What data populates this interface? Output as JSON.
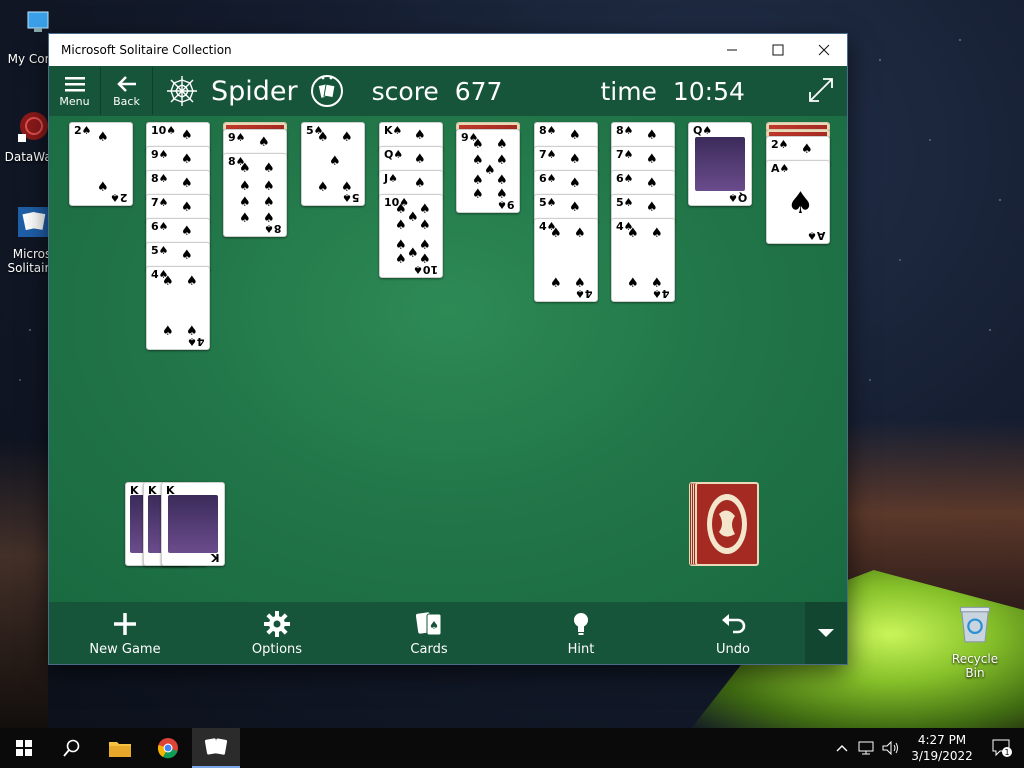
{
  "desktop": {
    "icons": [
      {
        "label": "My Com",
        "name": "my-computer"
      },
      {
        "label": "DataWag",
        "name": "datawag"
      },
      {
        "label": "Micros Solitaire",
        "line1": "Micros",
        "line2": "Solitaire",
        "name": "microsoft-solitaire"
      }
    ],
    "recycle_bin": "Recycle Bin"
  },
  "window": {
    "title": "Microsoft Solitaire Collection"
  },
  "appbar": {
    "menu_label": "Menu",
    "back_label": "Back",
    "game_name": "Spider",
    "score_label": "score",
    "score_value": "677",
    "time_label": "time",
    "time_value": "10:54"
  },
  "tableau": [
    {
      "column": 1,
      "hidden": 0,
      "cards": [
        "2♠"
      ]
    },
    {
      "column": 2,
      "hidden": 0,
      "cards": [
        "10♠",
        "9♠",
        "8♠",
        "7♠",
        "6♠",
        "5♠",
        "4♠"
      ]
    },
    {
      "column": 3,
      "hidden": 1,
      "cards": [
        "9♠",
        "8♠"
      ]
    },
    {
      "column": 4,
      "hidden": 0,
      "cards": [
        "5♠"
      ]
    },
    {
      "column": 5,
      "hidden": 0,
      "cards": [
        "K♠",
        "Q♠",
        "J♠",
        "10♠"
      ]
    },
    {
      "column": 6,
      "hidden": 1,
      "cards": [
        "9♠"
      ]
    },
    {
      "column": 7,
      "hidden": 0,
      "cards": [
        "8♠",
        "7♠",
        "6♠",
        "5♠",
        "4♠"
      ]
    },
    {
      "column": 8,
      "hidden": 0,
      "cards": [
        "8♠",
        "7♠",
        "6♠",
        "5♠",
        "4♠"
      ]
    },
    {
      "column": 9,
      "hidden": 0,
      "cards": [
        "Q♠"
      ]
    },
    {
      "column": 10,
      "hidden": 2,
      "cards": [
        "2♠",
        "A♠"
      ]
    }
  ],
  "completed_runs": [
    "K",
    "K",
    "K"
  ],
  "stock_label": "stock",
  "bottombar": {
    "new_game": "New Game",
    "options": "Options",
    "cards": "Cards",
    "hint": "Hint",
    "undo": "Undo"
  },
  "taskbar": {
    "time": "4:27 PM",
    "date": "3/19/2022",
    "notification_count": "1"
  },
  "colors": {
    "felt": "#217548",
    "bar": "#17553a",
    "card_back": "#a52a22"
  }
}
